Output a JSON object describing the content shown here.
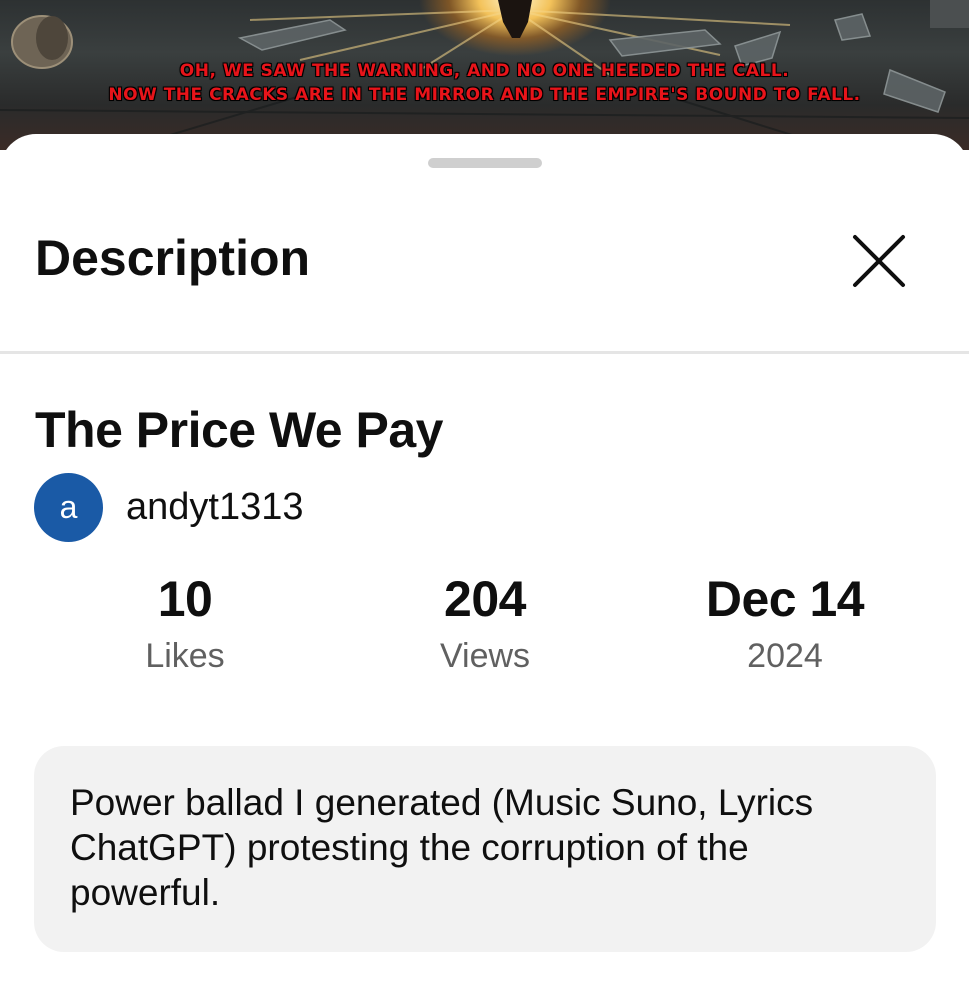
{
  "thumbnail": {
    "lyrics_line_1": "OH, WE SAW THE WARNING, AND NO ONE HEEDED THE CALL.",
    "lyrics_line_2": "NOW THE CRACKS ARE IN THE MIRROR AND THE EMPIRE'S BOUND TO FALL."
  },
  "sheet": {
    "title": "Description",
    "close_icon": "close-icon"
  },
  "video": {
    "title": "The Price We Pay",
    "channel": {
      "avatar_letter": "a",
      "avatar_color": "#1a5aa6",
      "name": "andyt1313"
    },
    "stats": {
      "likes": {
        "value": "10",
        "label": "Likes"
      },
      "views": {
        "value": "204",
        "label": "Views"
      },
      "date": {
        "value": "Dec 14",
        "label": "2024"
      }
    },
    "description": "Power ballad I generated (Music Suno, Lyrics ChatGPT) protesting the corruption of the powerful."
  }
}
